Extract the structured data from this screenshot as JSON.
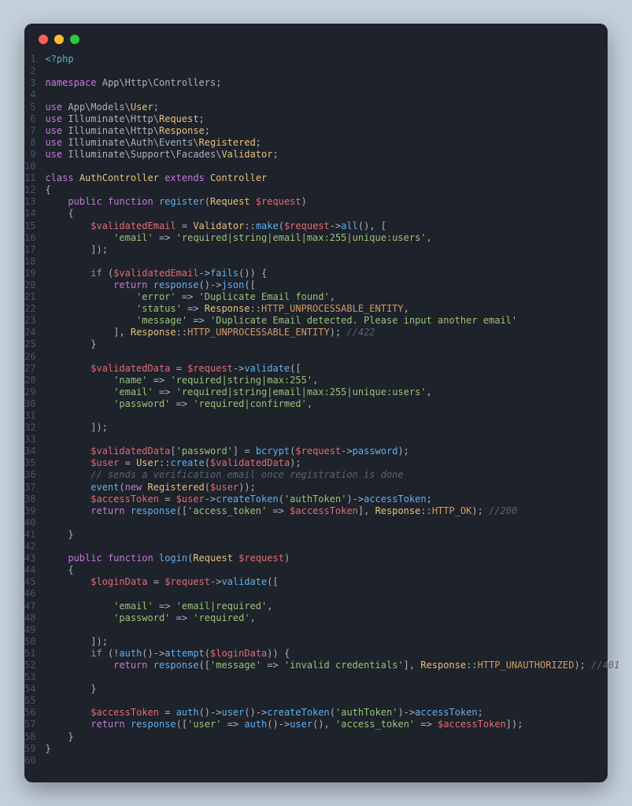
{
  "window": {
    "dots": [
      "red",
      "yellow",
      "green"
    ]
  },
  "source": {
    "language": "php",
    "line_count": 60
  },
  "code": {
    "l1": "<?php",
    "l3_ns": "namespace",
    "l3_path": "App\\Http\\Controllers",
    "l5_use": "use",
    "l5_p1": "App\\Models\\",
    "l5_c": "User",
    "l6_p1": "Illuminate\\Http\\",
    "l6_c": "Request",
    "l7_c": "Response",
    "l8_p1": "Illuminate\\Auth\\Events\\",
    "l8_c": "Registered",
    "l9_p1": "Illuminate\\Support\\Facades\\",
    "l9_c": "Validator",
    "kw_class": "class",
    "kw_extends": "extends",
    "cls_auth": "AuthController",
    "cls_ctrl": "Controller",
    "kw_public": "public",
    "kw_function": "function",
    "fn_register": "register",
    "fn_login": "login",
    "cls_request": "Request",
    "var_request": "$request",
    "var_valemail": "$validatedEmail",
    "cls_validator": "Validator",
    "m_make": "make",
    "m_all": "all",
    "s_email": "'email'",
    "s_email_rule": "'required|string|email|max:255|unique:users'",
    "kw_if": "if",
    "m_fails": "fails",
    "kw_return": "return",
    "fn_response": "response",
    "m_json": "json",
    "s_error": "'error'",
    "s_dup": "'Duplicate Email found'",
    "s_status": "'status'",
    "cls_response": "Response",
    "c_422": "HTTP_UNPROCESSABLE_ENTITY",
    "s_message": "'message'",
    "s_dup_msg": "'Duplicate Email detected. Please input another email'",
    "cmt_422": "//422",
    "var_valdata": "$validatedData",
    "m_validate": "validate",
    "s_name": "'name'",
    "s_name_rule": "'required|string|max:255'",
    "s_password": "'password'",
    "s_pwd_rule": "'required|confirmed'",
    "fn_bcrypt": "bcrypt",
    "m_password": "password",
    "var_user": "$user",
    "cls_user": "User",
    "m_create": "create",
    "cmt_verify": "// sends a verification email once registration is done",
    "fn_event": "event",
    "kw_new": "new",
    "cls_registered": "Registered",
    "var_atoken": "$accessToken",
    "m_createtoken": "createToken",
    "s_authtoken": "'authToken'",
    "m_accesstoken": "accessToken",
    "s_access_token": "'access_token'",
    "c_200": "HTTP_OK",
    "cmt_200": "//200",
    "var_logindata": "$loginData",
    "s_email_req": "'email|required'",
    "s_required": "'required'",
    "fn_auth": "auth",
    "m_attempt": "attempt",
    "s_invalid": "'invalid credentials'",
    "c_401": "HTTP_UNAUTHORIZED",
    "cmt_401": "//401",
    "m_user": "user",
    "s_user": "'user'"
  }
}
